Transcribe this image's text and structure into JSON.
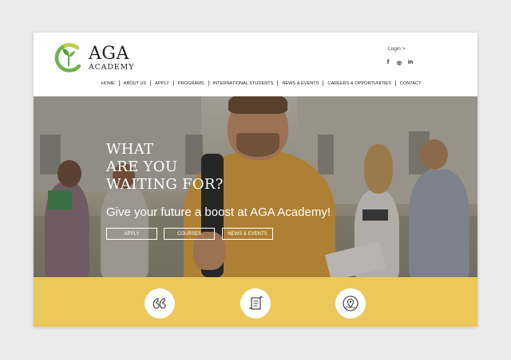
{
  "brand": {
    "name": "AGA",
    "sub": "ACADEMY",
    "colors": {
      "green": "#5aa53f",
      "yellow": "#ecc75a"
    }
  },
  "header": {
    "login": "Login >",
    "socials": [
      {
        "icon": "facebook-icon",
        "glyph": "f"
      },
      {
        "icon": "instagram-icon",
        "glyph": "◎"
      },
      {
        "icon": "linkedin-icon",
        "glyph": "in"
      }
    ]
  },
  "nav": {
    "items": [
      "HOME",
      "ABOUT US",
      "APPLY",
      "PROGRAMS",
      "INTERNATIONAL STUDENTS",
      "NEWS & EVENTS",
      "CAREERS & OPPORTUNITIES",
      "CONTACT"
    ]
  },
  "hero": {
    "title_line1": "WHAT",
    "title_line2": "ARE YOU",
    "title_line3": "WAITING FOR?",
    "subtitle": "Give your future a boost at AGA Academy!",
    "buttons": {
      "apply": "APPLY",
      "courses": "COURSES",
      "news": "NEWS & EVENTS"
    }
  },
  "features": {
    "icons": [
      "quote-icon",
      "scroll-icon",
      "location-icon"
    ]
  }
}
